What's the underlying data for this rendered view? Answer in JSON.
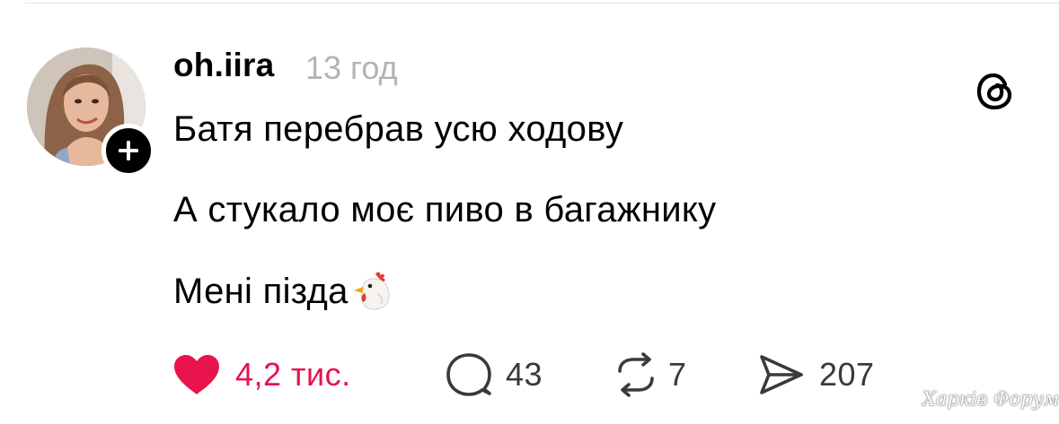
{
  "post": {
    "author": {
      "username": "oh.iira",
      "timestamp": "13 год",
      "avatar_icon": "profile-photo",
      "follow_icon": "plus-icon"
    },
    "app_icon": "threads-logo-icon",
    "lines": [
      "Батя перебрав усю ходову",
      "А стукало моє пиво в багажнику",
      "Мені пізда"
    ],
    "trailing_emoji": "chicken-emoji"
  },
  "actions": {
    "like": {
      "icon": "heart-filled-icon",
      "count": "4,2 тис.",
      "color": "#e8134a"
    },
    "comment": {
      "icon": "comment-bubble-icon",
      "count": "43"
    },
    "repost": {
      "icon": "repost-icon",
      "count": "7"
    },
    "share": {
      "icon": "send-icon",
      "count": "207"
    }
  },
  "watermark": "Харків Форум"
}
